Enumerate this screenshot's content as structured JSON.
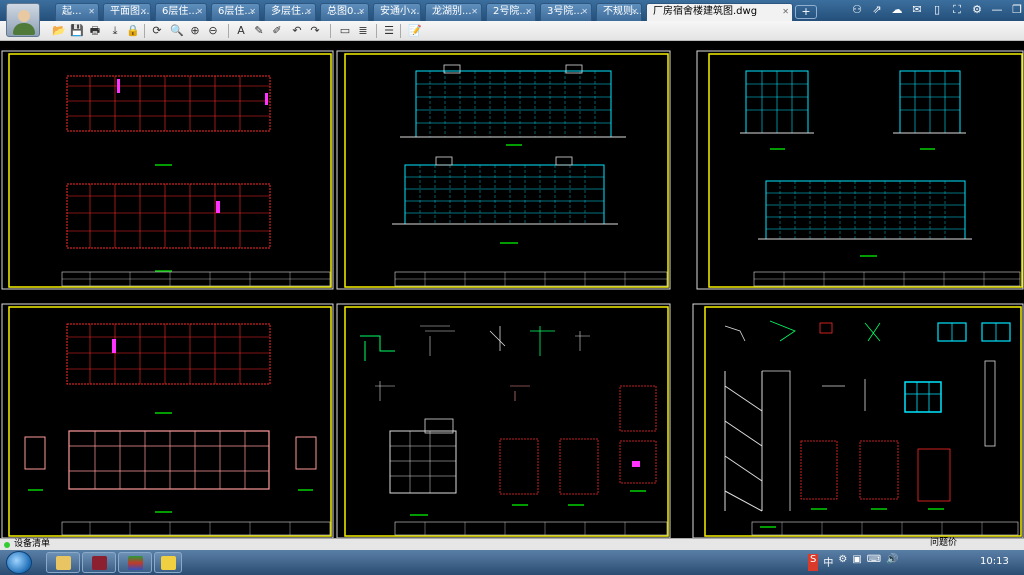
{
  "tabs": [
    {
      "label": "起...",
      "active": false
    },
    {
      "label": "平面图...",
      "active": false
    },
    {
      "label": "6层住...",
      "active": false
    },
    {
      "label": "6层住...",
      "active": false
    },
    {
      "label": "多层住...",
      "active": false
    },
    {
      "label": "总图0...",
      "active": false
    },
    {
      "label": "安通小...",
      "active": false
    },
    {
      "label": "龙湖别...",
      "active": false
    },
    {
      "label": "2号院...",
      "active": false
    },
    {
      "label": "3号院...",
      "active": false
    },
    {
      "label": "不规则...",
      "active": false
    },
    {
      "label": "厂房宿舍楼建筑图.dwg",
      "active": true
    }
  ],
  "new_tab_label": "+",
  "window_icons": [
    "user-icon",
    "share-icon",
    "cloud-icon",
    "mail-icon",
    "phone-icon",
    "fullscreen-icon",
    "settings-icon",
    "minimize-icon",
    "restore-icon",
    "close-icon"
  ],
  "window_glyphs": [
    "⚇",
    "⇗",
    "☁",
    "✉",
    "▯",
    "⛶",
    "⚙",
    "—",
    "❐",
    "✕"
  ],
  "toolbar": [
    "open-icon",
    "save-icon",
    "print-icon",
    "export-icon",
    "lock-icon",
    "rotate-icon",
    "zoom-window-icon",
    "zoom-in-icon",
    "zoom-out-icon",
    "text-icon",
    "pencil-icon",
    "highlight-icon",
    "undo-icon",
    "redo-icon",
    "measure-icon",
    "layer-icon",
    "layers-icon",
    "notes-icon"
  ],
  "toolbar_glyphs": [
    "📂",
    "💾",
    "🖶",
    "⤓",
    "🔒",
    "⟳",
    "🔍",
    "⊕",
    "⊖",
    "A",
    "✎",
    "✐",
    "↶",
    "↷",
    "▭",
    "≣",
    "☰",
    "📝"
  ],
  "status": {
    "text": "设备清单",
    "help": "问题价"
  },
  "taskbar": {
    "apps": [
      "explorer-app",
      "media-app",
      "archive-app",
      "cad-app"
    ],
    "tray": [
      "S",
      "中",
      "⚙",
      "▣",
      "⌨",
      "🔊"
    ],
    "time": "10:13"
  },
  "colors": {
    "title_frame": "#f5f000",
    "grid": "#ff2a2a",
    "facade": "#00e5ff",
    "label": "#00d000",
    "magenta": "#ff33ff",
    "tab_active": "#f2f2f2"
  }
}
